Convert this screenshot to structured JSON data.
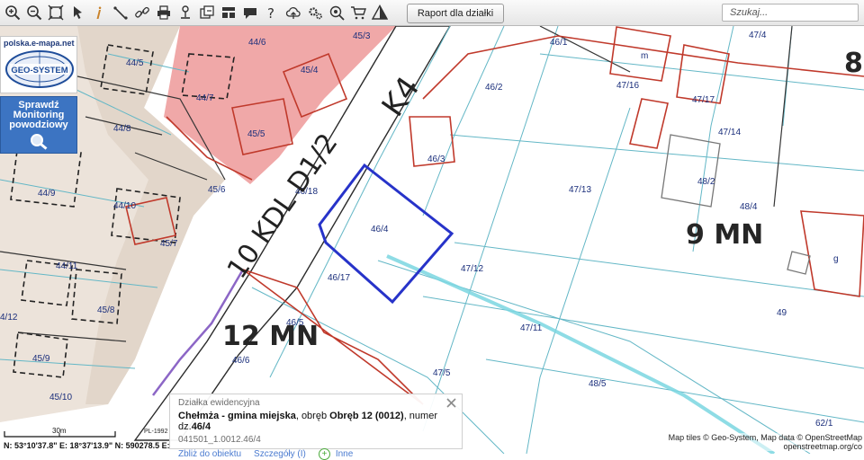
{
  "toolbar": {
    "icons": [
      "zoom-in-icon",
      "zoom-out-icon",
      "zoom-extent-icon",
      "pointer-icon",
      "info-icon",
      "measure-icon",
      "link-icon",
      "print-icon",
      "pin-icon",
      "export-icon",
      "layout-icon",
      "comment-icon",
      "help-icon",
      "cloud-upload-icon",
      "settings-icon",
      "locate-icon",
      "cart-icon",
      "warning-icon"
    ],
    "report_button": "Raport dla działki",
    "search_placeholder": "Szukaj..."
  },
  "brand": {
    "url": "polska.e-mapa.net",
    "logo_text": "GEO-SYSTEM"
  },
  "flood_button": {
    "line1": "Sprawdź",
    "line2": "Monitoring",
    "line3": "powodziowy"
  },
  "map": {
    "road_label": "10 KDL D1/2",
    "road_code": "K4",
    "zones": [
      "12 MN",
      "9 MN",
      "8"
    ],
    "parcels": [
      "44/6",
      "45/3",
      "46/1",
      "47/4",
      "44/5",
      "45/4",
      "46/2",
      "47/16",
      "47/17",
      "44/7",
      "m",
      "44/8",
      "45/5",
      "46/3",
      "47/14",
      "48/2",
      "44/9",
      "45/6",
      "46/18",
      "47/13",
      "48/4",
      "44/10",
      "45/7",
      "46/4",
      "44/11",
      "46/17",
      "47/12",
      "4/12",
      "45/8",
      "46/5",
      "47/11",
      "49",
      "45/9",
      "46/6",
      "47/5",
      "48/5",
      "45/10",
      "62/1",
      "g"
    ]
  },
  "popup": {
    "title": "Działka ewidencyjna",
    "municipality": "Chełmża - gmina miejska",
    "obreb_prefix": ", obręb ",
    "obreb": "Obręb 12 (0012)",
    "number_prefix": ", numer dz.",
    "number": "46/4",
    "code": "041501_1.0012.46/4",
    "link_zoom": "Zbliż do obiektu",
    "link_details": "Szczegóły (I)",
    "link_more": "Inne"
  },
  "scale": {
    "label": "30m"
  },
  "coords": {
    "text": "N: 53°10'37.8\" E: 18°37'13.9\" N: 590278.5 E:"
  },
  "crs": {
    "label": "PL-1992"
  },
  "attribution": {
    "line1": "Map tiles © Geo-System, Map data © OpenStreetMap",
    "line2": "openstreetmap.org/co"
  }
}
